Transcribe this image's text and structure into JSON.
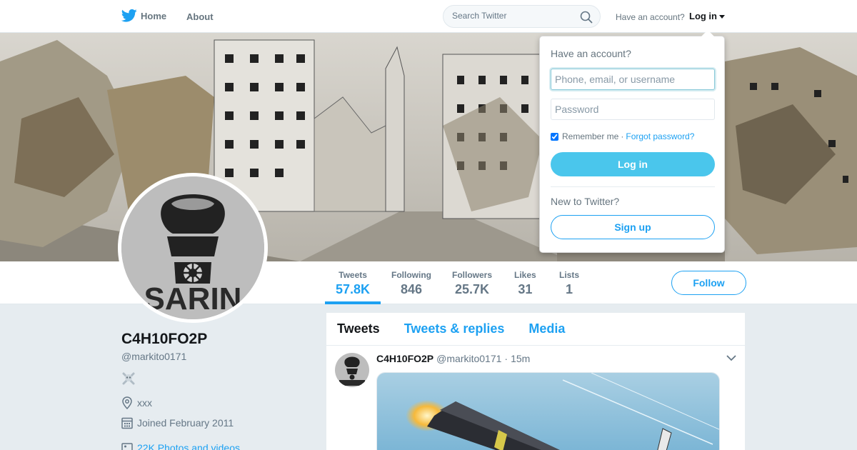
{
  "nav": {
    "home_label": "Home",
    "about_label": "About",
    "search_placeholder": "Search Twitter",
    "have_account_label": "Have an account?",
    "login_label": "Log in"
  },
  "profile": {
    "name": "C4H10FO2P",
    "handle": "@markito0171",
    "location": "xxx",
    "joined": "Joined February 2011",
    "photos_link": "22K Photos and videos",
    "avatar_text": "SARIN",
    "follow_label": "Follow"
  },
  "stats": [
    {
      "label": "Tweets",
      "value": "57.8K"
    },
    {
      "label": "Following",
      "value": "846"
    },
    {
      "label": "Followers",
      "value": "25.7K"
    },
    {
      "label": "Likes",
      "value": "31"
    },
    {
      "label": "Lists",
      "value": "1"
    }
  ],
  "timeline": {
    "tabs": [
      "Tweets",
      "Tweets & replies",
      "Media"
    ],
    "tweet": {
      "name": "C4H10FO2P",
      "handle": "@markito0171",
      "separator": "·",
      "time": "15m"
    }
  },
  "login_dropdown": {
    "title": "Have an account?",
    "username_placeholder": "Phone, email, or username",
    "password_placeholder": "Password",
    "remember_label": "Remember me",
    "separator": "·",
    "forgot_label": "Forgot password?",
    "login_button": "Log in",
    "new_label": "New to Twitter?",
    "signup_button": "Sign up"
  },
  "colors": {
    "accent": "#1da1f2",
    "login_button": "#4ac6ec",
    "background": "#e6ecf0"
  },
  "icons": [
    "twitter-bird-icon",
    "search-icon",
    "caret-down-icon",
    "skull-crossbones-icon",
    "location-icon",
    "calendar-icon",
    "photo-icon",
    "chevron-down-icon"
  ]
}
